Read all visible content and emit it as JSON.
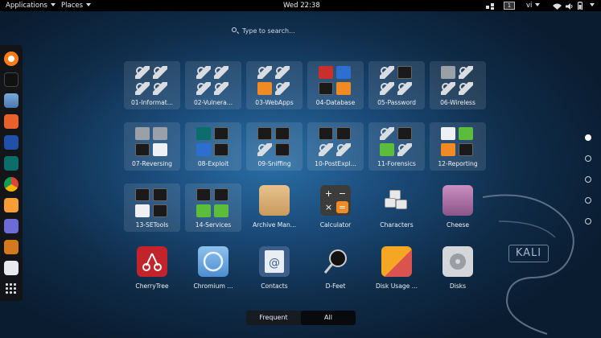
{
  "topbar": {
    "applications": "Applications",
    "places": "Places",
    "clock": "Wed 22:38",
    "workspace": "1",
    "keyboard": "vi"
  },
  "search": {
    "placeholder": "Type to search..."
  },
  "dash": [
    "firefox-icon",
    "terminal-icon",
    "files-icon",
    "burpsuite-icon",
    "metasploit-icon",
    "maltego-icon",
    "chrome-icon",
    "screenshot-icon",
    "notes-icon",
    "s-app-icon",
    "app-icon",
    "show-apps-icon"
  ],
  "grid": {
    "folders": [
      "01-Informat...",
      "02-Vulnera...",
      "03-WebApps",
      "04-Database",
      "05-Password",
      "06-Wireless",
      "07-Reversing",
      "08-Exploit",
      "09-Sniffing",
      "10-PostExpl...",
      "11-Forensics",
      "12-Reporting",
      "13-SETools",
      "14-Services"
    ],
    "apps": [
      "Archive Man...",
      "Calculator",
      "Characters",
      "Cheese",
      "CherryTree",
      "Chromium ...",
      "Contacts",
      "D-Feet",
      "Disk Usage ...",
      "Disks"
    ]
  },
  "logo": "KALI",
  "view_switch": {
    "frequent": "Frequent",
    "all": "All",
    "selected": "All"
  },
  "pages": {
    "count": 5,
    "current": 1
  }
}
